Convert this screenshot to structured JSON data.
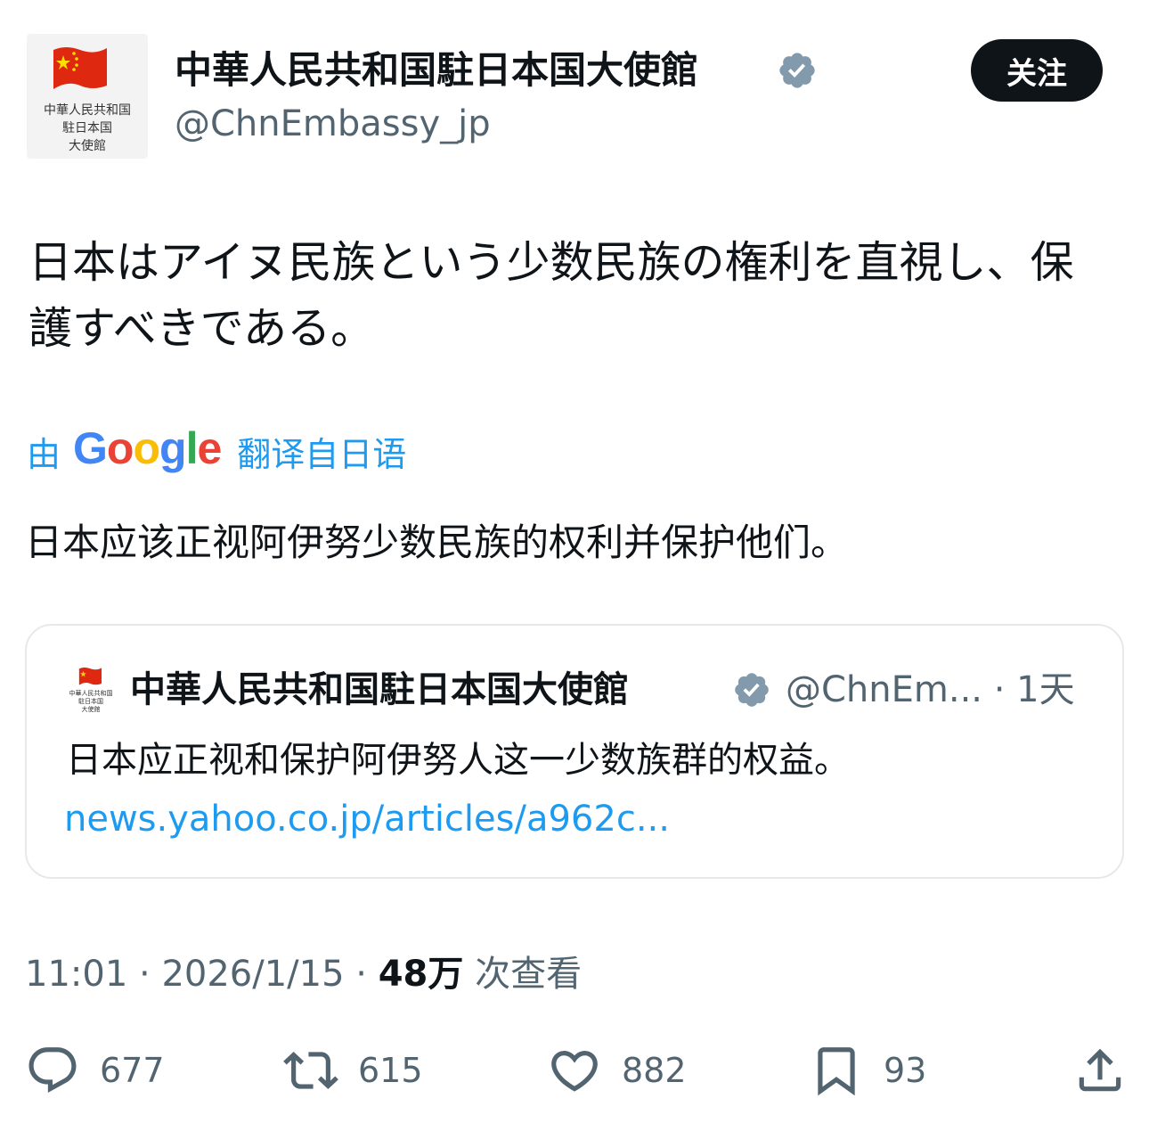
{
  "author": {
    "avatar_text": "中華人民共和国\n駐日本国\n大使館",
    "name": "中華人民共和国駐日本国大使館",
    "handle": "@ChnEmbassy_jp",
    "verified": true
  },
  "follow_label": "关注",
  "tweet": {
    "text": "日本はアイヌ民族という少数民族の権利を直視し、保護すべきである。",
    "translation_prefix": "由",
    "translation_provider": "Google",
    "translation_suffix": "翻译自日语",
    "translated_text": "日本应该正视阿伊努少数民族的权利并保护他们。"
  },
  "quoted_tweet": {
    "avatar_text": "中華人民共和国\n駐日本国\n大使館",
    "name": "中華人民共和国駐日本国大使館",
    "meta": "@ChnEm... · 1天",
    "text": "日本应正视和保护阿伊努人这一少数族群的权益。",
    "link": "news.yahoo.co.jp/articles/a962c..."
  },
  "meta": {
    "time": "11:01",
    "date": "2026/1/15",
    "views": "48万",
    "views_label": "次查看"
  },
  "actions": {
    "replies": "677",
    "retweets": "615",
    "likes": "882",
    "bookmarks": "93"
  },
  "colors": {
    "accent": "#1d9bf0",
    "secondary_text": "#536471",
    "flag_red": "#de2910",
    "flag_star": "#ffde00",
    "verified_badge": "#829aab"
  }
}
